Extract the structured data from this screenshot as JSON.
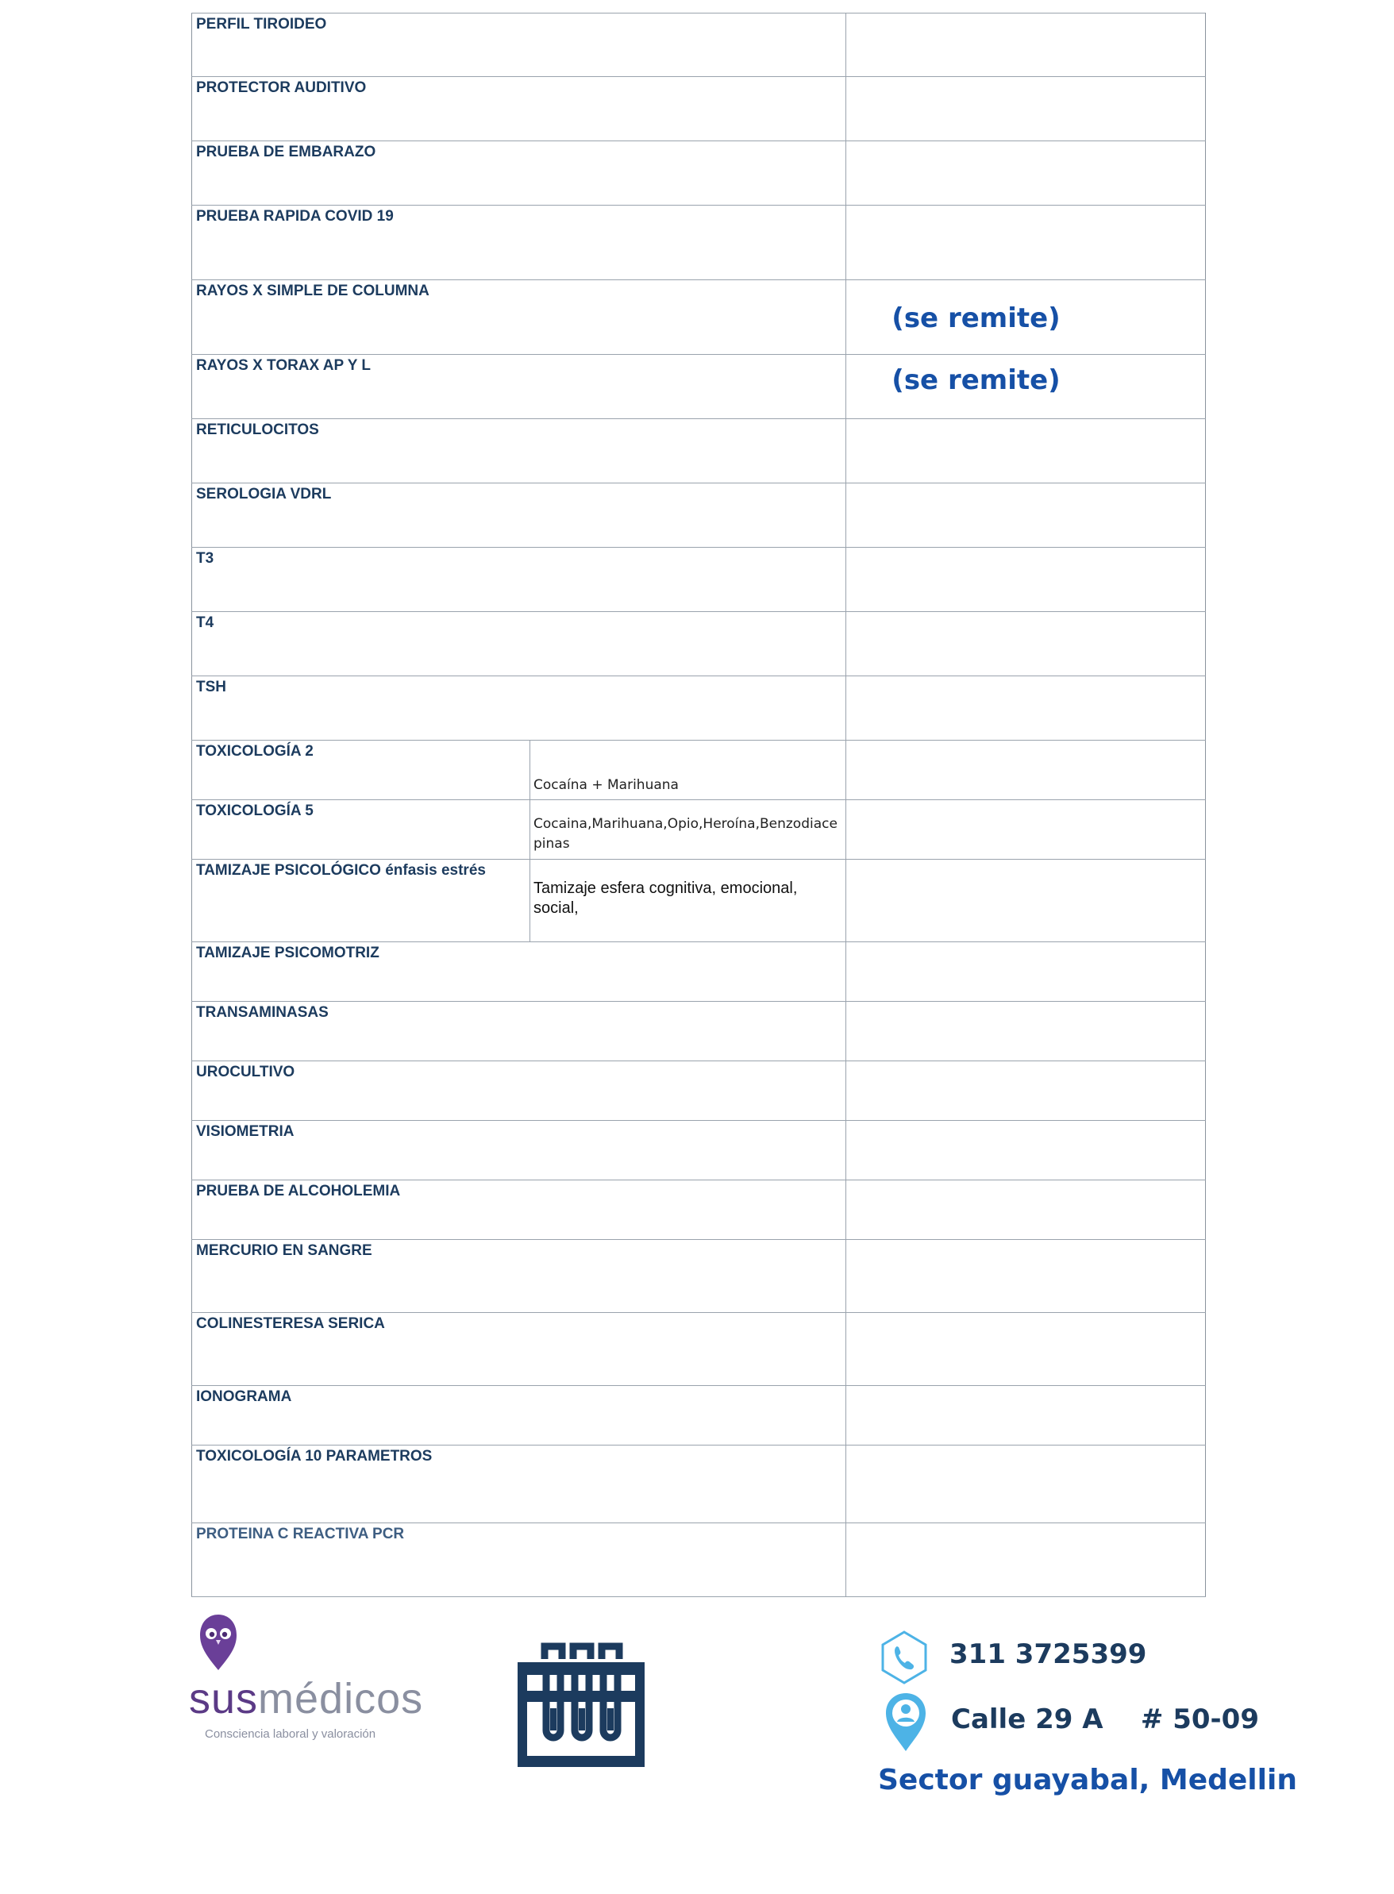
{
  "exams": [
    {
      "name": "PERFIL TIROIDEO",
      "detail": "",
      "note": ""
    },
    {
      "name": "PROTECTOR AUDITIVO",
      "detail": "",
      "note": ""
    },
    {
      "name": "PRUEBA DE EMBARAZO",
      "detail": "",
      "note": ""
    },
    {
      "name": "PRUEBA RAPIDA COVID 19",
      "detail": "",
      "note": ""
    },
    {
      "name": "RAYOS X SIMPLE  DE  COLUMNA",
      "detail": "",
      "note": "(se remite)"
    },
    {
      "name": "RAYOS X TORAX AP Y L",
      "detail": "",
      "note": "(se remite)"
    },
    {
      "name": "RETICULOCITOS",
      "detail": "",
      "note": ""
    },
    {
      "name": "SEROLOGIA VDRL",
      "detail": "",
      "note": ""
    },
    {
      "name": "T3",
      "detail": "",
      "note": ""
    },
    {
      "name": "T4",
      "detail": "",
      "note": ""
    },
    {
      "name": "TSH",
      "detail": "",
      "note": ""
    },
    {
      "name": "TOXICOLOGÍA 2",
      "detail": "Cocaína + Marihuana",
      "note": ""
    },
    {
      "name": "TOXICOLOGÍA 5",
      "detail": "Cocaina,Marihuana,Opio,Heroína,Benzodiacepinas",
      "note": ""
    },
    {
      "name": "TAMIZAJE PSICOLÓGICO énfasis estrés",
      "detail": "Tamizaje esfera cognitiva, emocional, social,",
      "note": ""
    },
    {
      "name": "TAMIZAJE PSICOMOTRIZ",
      "detail": "",
      "note": ""
    },
    {
      "name": "TRANSAMINASAS",
      "detail": "",
      "note": ""
    },
    {
      "name": "UROCULTIVO",
      "detail": "",
      "note": ""
    },
    {
      "name": "VISIOMETRIA",
      "detail": "",
      "note": ""
    },
    {
      "name": "PRUEBA DE ALCOHOLEMIA",
      "detail": "",
      "note": ""
    },
    {
      "name": "MERCURIO EN SANGRE",
      "detail": "",
      "note": ""
    },
    {
      "name": "COLINESTERESA SERICA",
      "detail": "",
      "note": ""
    },
    {
      "name": "IONOGRAMA",
      "detail": "",
      "note": ""
    },
    {
      "name": "TOXICOLOGÍA 10 PARAMETROS",
      "detail": "",
      "note": ""
    },
    {
      "name": "PROTEINA C REACTIVA PCR",
      "detail": "",
      "note": ""
    }
  ],
  "footer": {
    "brand_prefix": "sus",
    "brand_suffix": "médicos",
    "brand_tagline": "Consciencia laboral y valoración",
    "phone": "311 3725399",
    "address": "Calle 29 A    # 50-09",
    "sector": "Sector guayabal, Medellin",
    "phone_icon": "phone-icon",
    "location_icon": "location-pin-icon",
    "lab_icon": "test-tubes-icon",
    "brand_color": "#5b3a86",
    "accent_color": "#1650a6",
    "icon_color": "#4db3e6"
  }
}
